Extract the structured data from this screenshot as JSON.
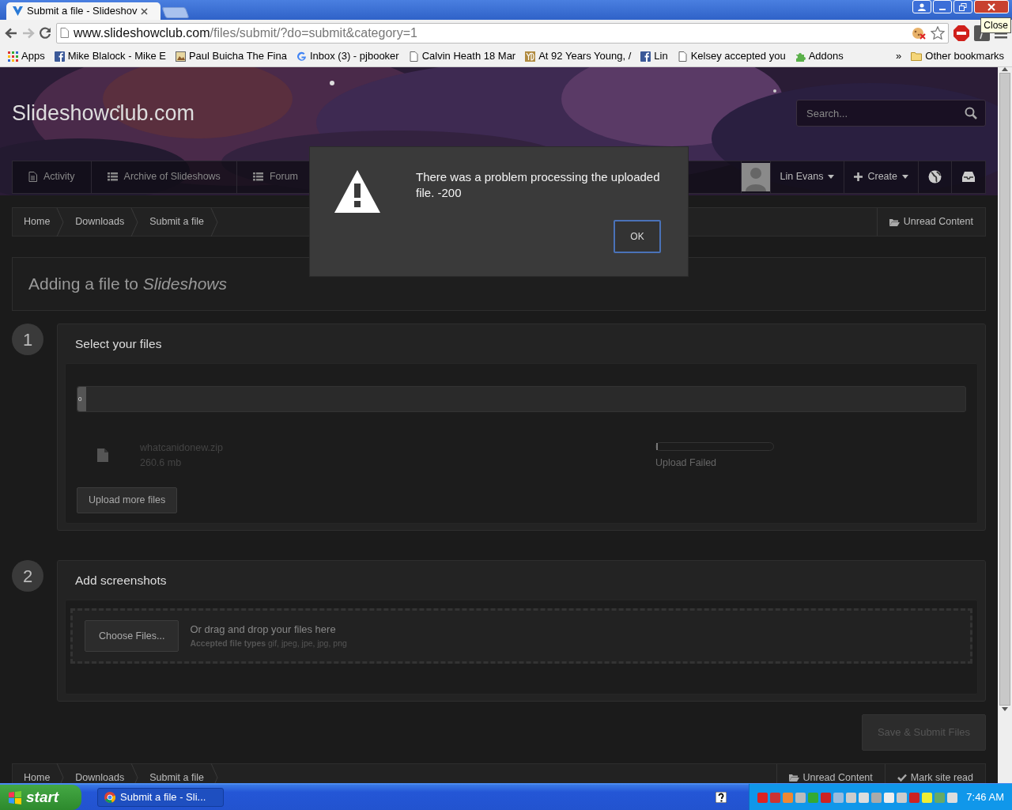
{
  "browser": {
    "tabs": [
      {
        "title": "Submit a file - Slideshov",
        "selected": true
      }
    ],
    "url": {
      "host": "www.slideshowclub.com",
      "path": "/files/submit/?do=submit&category=1"
    },
    "bookmarks": [
      {
        "label": "Apps",
        "kind": "apps"
      },
      {
        "label": "Mike Blalock - Mike E",
        "kind": "facebook"
      },
      {
        "label": "Paul Buicha The Fina"
      },
      {
        "label": "Inbox (3) - pjbooker",
        "kind": "google"
      },
      {
        "label": "Calvin Heath 18 Mar",
        "kind": "page"
      },
      {
        "label": "At 92 Years Young, /",
        "kind": "yd"
      },
      {
        "label": "Lin",
        "kind": "facebook"
      },
      {
        "label": "Kelsey accepted you",
        "kind": "page"
      },
      {
        "label": "Addons",
        "kind": "puzzle"
      }
    ],
    "more_bookmarks": "»",
    "other_bookmarks": "Other bookmarks",
    "tooltip": "Close"
  },
  "site": {
    "logo": "Slideshowclub.com",
    "search": {
      "placeholder": "Search..."
    },
    "nav": [
      {
        "label": "Activity",
        "kind": "page"
      },
      {
        "label": "Archive of Slideshows",
        "kind": "list"
      },
      {
        "label": "Forum",
        "kind": "list"
      }
    ],
    "user": "Lin Evans",
    "create": "Create"
  },
  "breadcrumb": {
    "items": [
      "Home",
      "Downloads",
      "Submit a file"
    ],
    "actions": [
      {
        "label": "Unread Content",
        "kind": "folder"
      }
    ]
  },
  "heading": "Adding a file to *Slideshows*",
  "step_1": {
    "number": "1",
    "title": "Select your files",
    "progress": {
      "level": 0.01,
      "label": "0"
    },
    "file": {
      "name": "whatcanidonew.zip",
      "size": "260.6 mb",
      "level": 0.01,
      "status": "Upload Failed"
    },
    "button": "Upload more files"
  },
  "step_2": {
    "number": "2",
    "title": "Add screenshots",
    "button": "Choose Files...",
    "hint": "Or drag and drop your files here",
    "types_label": "Accepted file types",
    "types": "gif, jpeg, jpe, jpg, png"
  },
  "submit": {
    "label": "Save & Submit Files",
    "disabled": true
  },
  "footer": {
    "items": [
      "Home",
      "Downloads",
      "Submit a file"
    ],
    "actions": [
      {
        "label": "Unread Content",
        "kind": "folder"
      },
      {
        "label": "Mark site read",
        "kind": "check"
      }
    ]
  },
  "dialog": {
    "message": "There was a problem processing the uploaded file. -200",
    "button": "OK"
  },
  "taskbar": {
    "start": "start",
    "tasks": [
      {
        "label": "Submit a file - Sli...",
        "selected": true
      }
    ],
    "clock": "7:46 AM"
  }
}
